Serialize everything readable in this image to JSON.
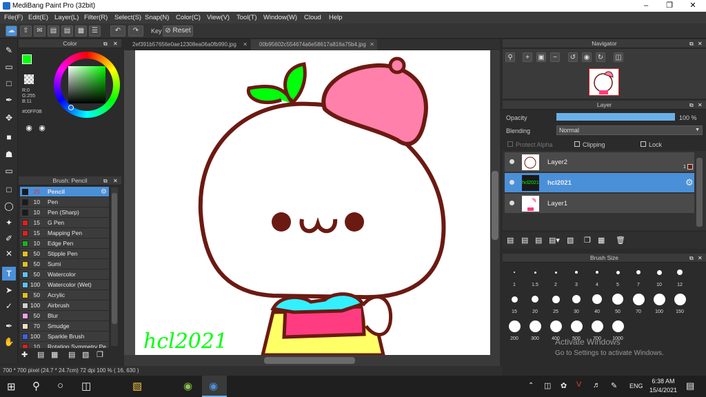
{
  "window": {
    "title": "MediBang Paint Pro (32bit)"
  },
  "menu": [
    "File(F)",
    "Edit(E)",
    "Layer(L)",
    "Filter(R)",
    "Select(S)",
    "Snap(N)",
    "Color(C)",
    "View(V)",
    "Tool(T)",
    "Window(W)",
    "Cloud",
    "Help"
  ],
  "toolbar": {
    "key_label": "Key",
    "reset_label": "Reset"
  },
  "color_panel": {
    "title": "Color",
    "r": "R:0",
    "g": "G:255",
    "b": "B:11",
    "hex": "#00FF0B",
    "fg_color": "#00ff0b"
  },
  "brush_panel": {
    "title": "Brush: Pencil",
    "items": [
      {
        "size": "25",
        "name": "Pencil",
        "color": "#1a1a1a"
      },
      {
        "size": "10",
        "name": "Pen",
        "color": "#1a1a1a"
      },
      {
        "size": "10",
        "name": "Pen (Sharp)",
        "color": "#1a1a1a"
      },
      {
        "size": "15",
        "name": "G Pen",
        "color": "#e02020"
      },
      {
        "size": "15",
        "name": "Mapping Pen",
        "color": "#e02020"
      },
      {
        "size": "10",
        "name": "Edge Pen",
        "color": "#20b020"
      },
      {
        "size": "50",
        "name": "Stipple Pen",
        "color": "#e0c020"
      },
      {
        "size": "50",
        "name": "Sumi",
        "color": "#e0c020"
      },
      {
        "size": "50",
        "name": "Watercolor",
        "color": "#60c0f0"
      },
      {
        "size": "100",
        "name": "Watercolor (Wet)",
        "color": "#60c0f0"
      },
      {
        "size": "50",
        "name": "Acrylic",
        "color": "#e0c020"
      },
      {
        "size": "100",
        "name": "Airbrush",
        "color": "#cfcfcf"
      },
      {
        "size": "50",
        "name": "Blur",
        "color": "#f0a0f0"
      },
      {
        "size": "70",
        "name": "Smudge",
        "color": "#f0e0c0"
      },
      {
        "size": "100",
        "name": "Sparkle Brush",
        "color": "#4060e0"
      },
      {
        "size": "10",
        "name": "Rotation Symmetry Pe",
        "color": "#e02020"
      }
    ]
  },
  "tabs": [
    "2ef391b57656e0ae12308ea06a0fb990.jpg",
    "00b95602c554674a6e58617a816a75b4.jpg"
  ],
  "canvas": {
    "signature_text": "hcl2021"
  },
  "statusbar": {
    "text": "700 * 700 pixel   (24.7 * 24.7cm)   72 dpi   100 %   ( 16, 630 )"
  },
  "navigator": {
    "title": "Navigator"
  },
  "layer_panel": {
    "title": "Layer",
    "opacity_label": "Opacity",
    "opacity_value": "100 %",
    "opacity": 100,
    "blending_label": "Blending",
    "blending_value": "Normal",
    "protect_alpha": "Protect Alpha",
    "clipping": "Clipping",
    "lock": "Lock",
    "layers": [
      {
        "name": "Layer2",
        "badge": "1"
      },
      {
        "name": "hcl2021"
      },
      {
        "name": "Layer1"
      }
    ]
  },
  "brush_size_panel": {
    "title": "Brush Size",
    "sizes": [
      "1",
      "1.5",
      "2",
      "3",
      "4",
      "5",
      "7",
      "10",
      "12",
      "15",
      "20",
      "25",
      "30",
      "40",
      "50",
      "70",
      "100",
      "150",
      "200",
      "300",
      "400",
      "500",
      "700",
      "1000"
    ]
  },
  "watermark": {
    "line1": "Activate Windows",
    "line2": "Go to Settings to activate Windows."
  },
  "taskbar": {
    "lang": "ENG",
    "time": "6:38 AM",
    "date": "15/4/2021"
  }
}
